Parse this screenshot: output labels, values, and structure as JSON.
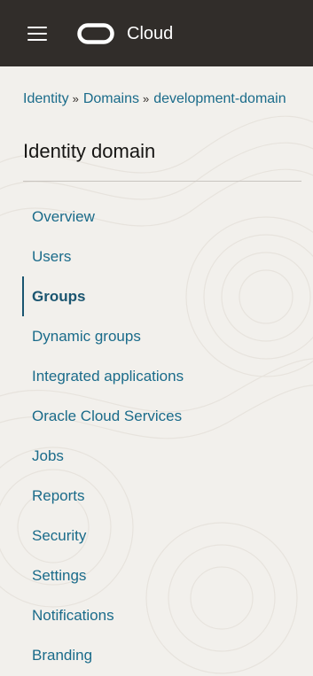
{
  "header": {
    "menu_icon": "hamburger-menu-icon",
    "logo_icon": "oracle-logo-icon",
    "brand": "Cloud",
    "colors": {
      "background": "#312d2a",
      "text": "#ffffff"
    }
  },
  "breadcrumb": {
    "items": [
      "Identity",
      "Domains",
      "development-domain"
    ],
    "separator": "»"
  },
  "page": {
    "title": "Identity domain"
  },
  "nav": {
    "items": [
      {
        "label": "Overview",
        "active": false
      },
      {
        "label": "Users",
        "active": false
      },
      {
        "label": "Groups",
        "active": true
      },
      {
        "label": "Dynamic groups",
        "active": false
      },
      {
        "label": "Integrated applications",
        "active": false
      },
      {
        "label": "Oracle Cloud Services",
        "active": false
      },
      {
        "label": "Jobs",
        "active": false
      },
      {
        "label": "Reports",
        "active": false
      },
      {
        "label": "Security",
        "active": false
      },
      {
        "label": "Settings",
        "active": false
      },
      {
        "label": "Notifications",
        "active": false
      },
      {
        "label": "Branding",
        "active": false
      }
    ]
  },
  "colors": {
    "link": "#1a6b8a",
    "active": "#1a5570",
    "page_background": "#f2f0ec"
  }
}
